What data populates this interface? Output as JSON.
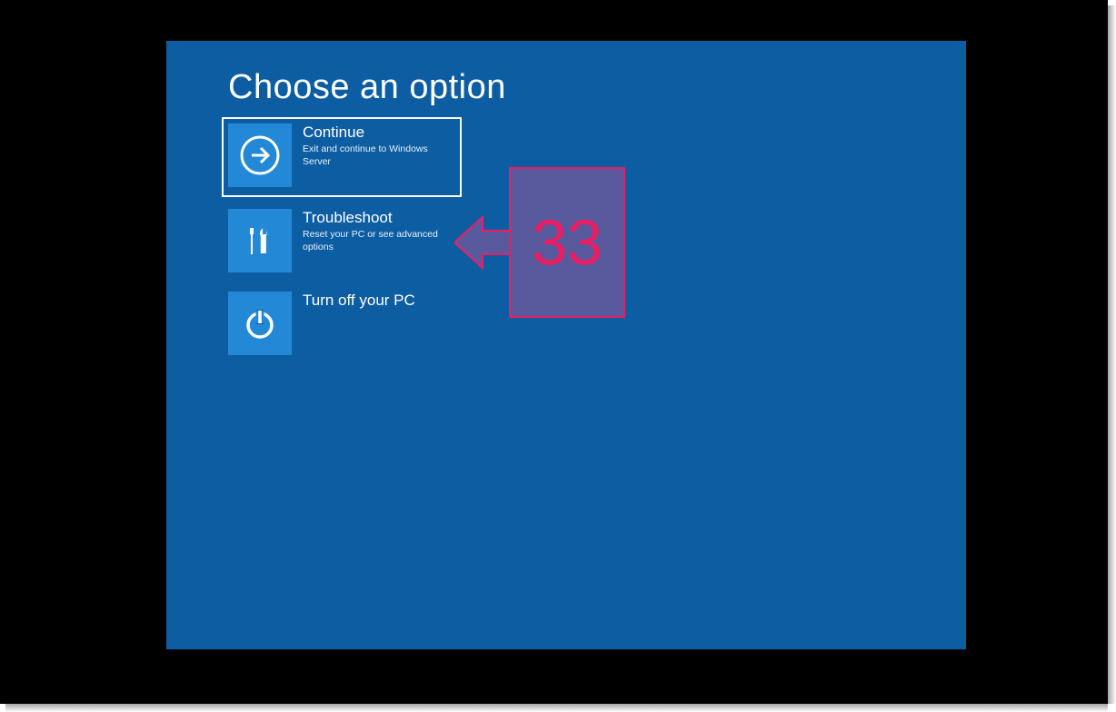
{
  "title": "Choose an option",
  "options": [
    {
      "title": "Continue",
      "desc": "Exit and continue to Windows Server"
    },
    {
      "title": "Troubleshoot",
      "desc": "Reset your PC or see advanced options"
    },
    {
      "title": "Turn off your PC",
      "desc": ""
    }
  ],
  "callout": {
    "number": "33"
  },
  "colors": {
    "panel": "#0d5da3",
    "tile": "#2389d6",
    "callout_border": "#e91e63",
    "callout_fill": "rgba(103, 88, 158, 0.85)"
  }
}
